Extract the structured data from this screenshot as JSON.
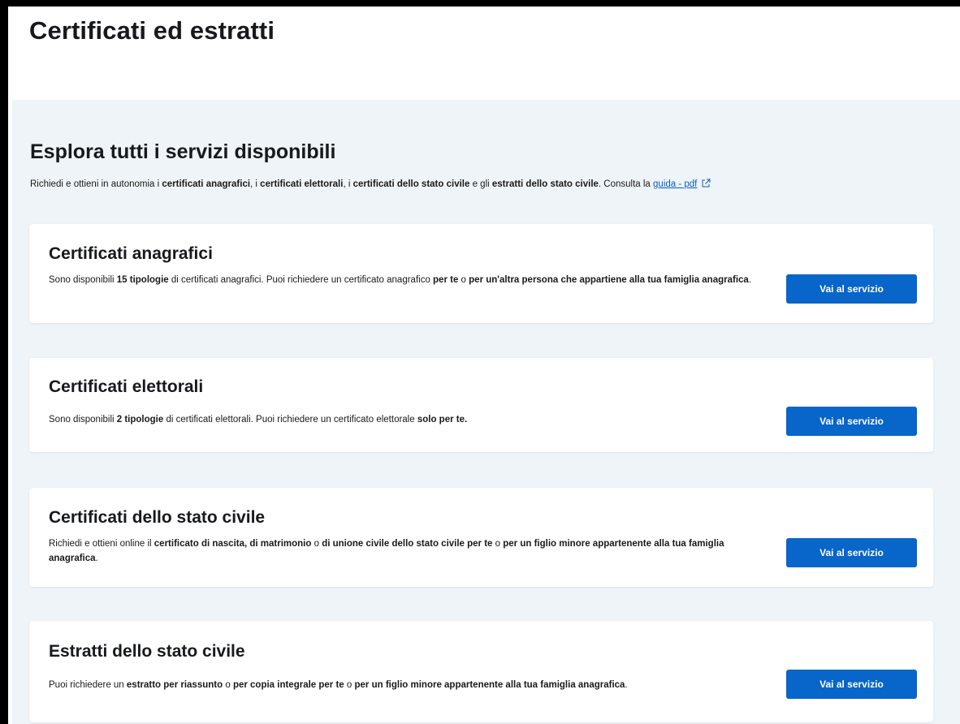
{
  "page": {
    "title": "Certificati ed estratti"
  },
  "explore": {
    "title": "Esplora tutti i servizi disponibili",
    "intro": [
      {
        "t": "Richiedi e ottieni in autonomia i "
      },
      {
        "t": "certificati anagrafici",
        "b": true
      },
      {
        "t": ", i "
      },
      {
        "t": "certificati elettorali",
        "b": true
      },
      {
        "t": ", i "
      },
      {
        "t": "certificati dello stato civile",
        "b": true
      },
      {
        "t": " e gli "
      },
      {
        "t": "estratti dello stato civile",
        "b": true
      },
      {
        "t": ". Consulta la "
      }
    ],
    "guide_link": "guida - pdf",
    "guide_icon": "external-link-icon"
  },
  "services": [
    {
      "title": "Certificati anagrafici",
      "desc": [
        {
          "t": "Sono disponibili "
        },
        {
          "t": "15 tipologie",
          "b": true
        },
        {
          "t": " di certificati anagrafici. Puoi richiedere un certificato anagrafico "
        },
        {
          "t": "per te",
          "b": true
        },
        {
          "t": " o "
        },
        {
          "t": "per un'altra persona che appartiene alla tua famiglia anagrafica",
          "b": true
        },
        {
          "t": "."
        }
      ],
      "button": "Vai al servizio"
    },
    {
      "title": "Certificati elettorali",
      "desc": [
        {
          "t": "Sono disponibili "
        },
        {
          "t": "2 tipologie",
          "b": true
        },
        {
          "t": " di certificati elettorali. Puoi richiedere un certificato elettorale "
        },
        {
          "t": "solo per te.",
          "b": true
        }
      ],
      "button": "Vai al servizio"
    },
    {
      "title": "Certificati dello stato civile",
      "desc": [
        {
          "t": "Richiedi e ottieni online il "
        },
        {
          "t": "certificato di nascita, di matrimonio",
          "b": true
        },
        {
          "t": " o "
        },
        {
          "t": "di unione civile dello stato civile per te",
          "b": true
        },
        {
          "t": " o "
        },
        {
          "t": "per un figlio minore appartenente alla tua famiglia anagrafica",
          "b": true
        },
        {
          "t": "."
        }
      ],
      "button": "Vai al servizio"
    },
    {
      "title": "Estratti dello stato civile",
      "desc": [
        {
          "t": "Puoi richiedere un "
        },
        {
          "t": "estratto per riassunto",
          "b": true
        },
        {
          "t": " o "
        },
        {
          "t": "per copia integrale per te",
          "b": true
        },
        {
          "t": " o "
        },
        {
          "t": "per un figlio minore appartenente alla tua famiglia anagrafica",
          "b": true
        },
        {
          "t": "."
        }
      ],
      "button": "Vai al servizio"
    }
  ],
  "colors": {
    "primary": "#0865c9",
    "section_bg": "#eff4f8",
    "link": "#0b5cc8"
  }
}
